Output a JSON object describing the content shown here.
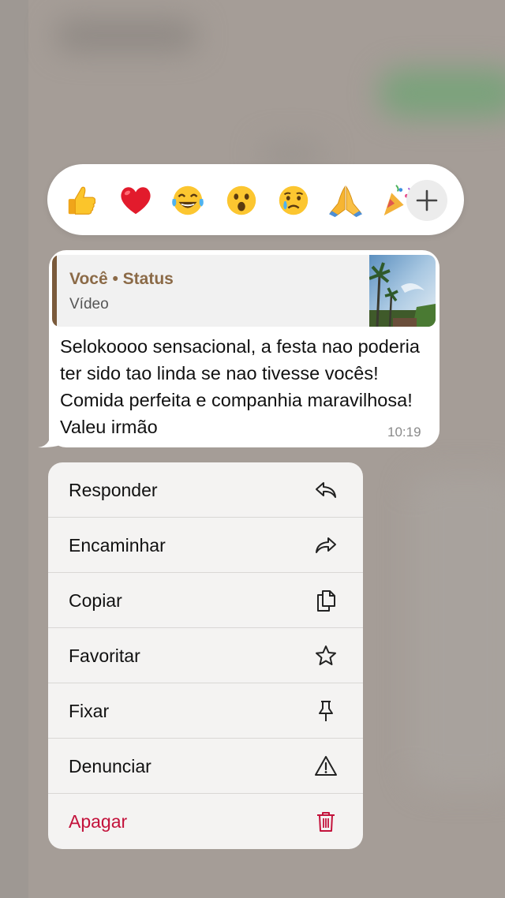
{
  "reactions": [
    {
      "icon": "thumbs-up-icon"
    },
    {
      "icon": "red-heart-icon"
    },
    {
      "icon": "tears-of-joy-icon"
    },
    {
      "icon": "surprised-face-icon"
    },
    {
      "icon": "crying-face-icon"
    },
    {
      "icon": "folded-hands-icon"
    },
    {
      "icon": "party-popper-icon"
    }
  ],
  "add_reaction_icon": "plus-icon",
  "message": {
    "quote_title": "Você • Status",
    "quote_subtitle": "Vídeo",
    "text": "Selokoooo sensacional, a festa nao poderia ter sido tao linda se nao tivesse vocês! Comida perfeita e companhia maravilhosa! Valeu irmão",
    "time": "10:19"
  },
  "menu": {
    "items": [
      {
        "label": "Responder",
        "icon": "reply-icon"
      },
      {
        "label": "Encaminhar",
        "icon": "forward-icon"
      },
      {
        "label": "Copiar",
        "icon": "copy-icon"
      },
      {
        "label": "Favoritar",
        "icon": "star-icon"
      },
      {
        "label": "Fixar",
        "icon": "pin-icon"
      },
      {
        "label": "Denunciar",
        "icon": "warning-icon"
      },
      {
        "label": "Apagar",
        "icon": "trash-icon"
      }
    ]
  },
  "colors": {
    "danger": "#c3123b",
    "quote_accent": "#8b6a47",
    "overlay": "#a59d97"
  }
}
